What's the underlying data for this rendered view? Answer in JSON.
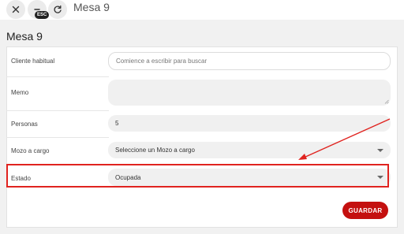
{
  "topbar": {
    "close_icon": "close-icon",
    "minimize_icon": "minimize-icon",
    "esc_badge": "ESC",
    "refresh_icon": "refresh-icon",
    "title": "Mesa 9"
  },
  "form": {
    "section_title": "Mesa 9",
    "cliente": {
      "label": "Cliente habitual",
      "placeholder": "Comience a escribir para buscar",
      "value": ""
    },
    "memo": {
      "label": "Memo",
      "value": ""
    },
    "personas": {
      "label": "Personas",
      "value": "5"
    },
    "mozo": {
      "label": "Mozo a cargo",
      "selected": "Seleccione un Mozo a cargo"
    },
    "estado": {
      "label": "Estado",
      "selected": "Ocupada"
    },
    "save_label": "GUARDAR"
  },
  "annotation": {
    "color": "#e0231f"
  },
  "colors": {
    "primary": "#c4100f",
    "field_bg": "#f0f0f0"
  }
}
